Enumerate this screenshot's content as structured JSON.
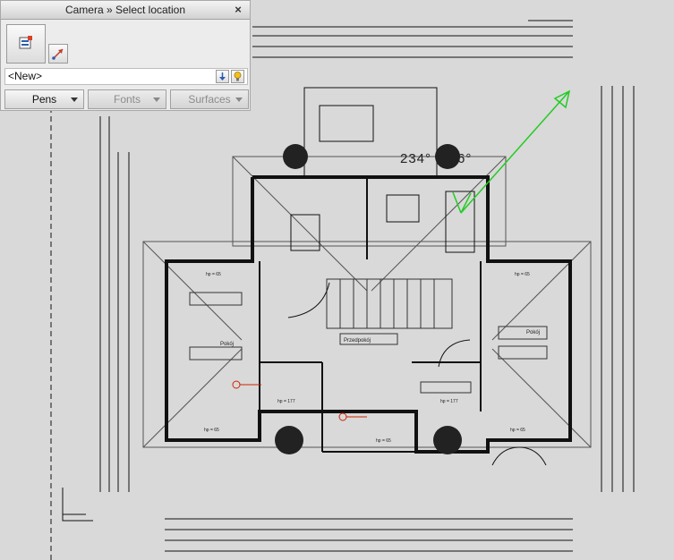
{
  "panel": {
    "title": "Camera » Select location",
    "close_label": "×",
    "location_value": "<New>",
    "dropdowns": [
      {
        "label": "Pens",
        "enabled": true
      },
      {
        "label": "Fonts",
        "enabled": false
      },
      {
        "label": "Surfaces",
        "enabled": false
      }
    ]
  },
  "drawing": {
    "camera_readout": "234° 26.6°",
    "room_labels": [
      "Przedpokój",
      "Pokój"
    ],
    "level_labels": [
      "hp = 65",
      "hp = 65",
      "hp = 177",
      "hp = 65",
      "hp = 65",
      "hp = 177",
      "hp = 65"
    ],
    "camera_color": "#22cc22",
    "marker_color": "#cc2200"
  }
}
